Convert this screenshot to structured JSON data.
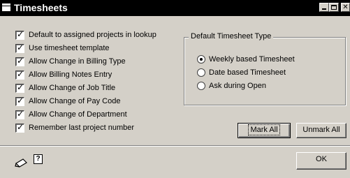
{
  "window": {
    "title": "Timesheets"
  },
  "options": [
    {
      "label": "Default to assigned projects in lookup",
      "checked": true
    },
    {
      "label": "Use timesheet template",
      "checked": true
    },
    {
      "label": "Allow Change in Billing Type",
      "checked": true
    },
    {
      "label": "Allow Billing Notes Entry",
      "checked": true
    },
    {
      "label": "Allow Change of Job Title",
      "checked": true
    },
    {
      "label": "Allow Change of Pay Code",
      "checked": true
    },
    {
      "label": "Allow Change of Department",
      "checked": true
    },
    {
      "label": "Remember last project number",
      "checked": true
    }
  ],
  "timesheet_type": {
    "title": "Default Timesheet Type",
    "options": [
      {
        "label": "Weekly based Timesheet",
        "selected": true
      },
      {
        "label": "Date based Timesheet",
        "selected": false
      },
      {
        "label": "Ask during Open",
        "selected": false
      }
    ]
  },
  "buttons": {
    "mark_all": "Mark All",
    "unmark_all": "Unmark All",
    "ok": "OK"
  },
  "icons": {
    "note": "pencil-note-icon",
    "help": "help-icon"
  }
}
